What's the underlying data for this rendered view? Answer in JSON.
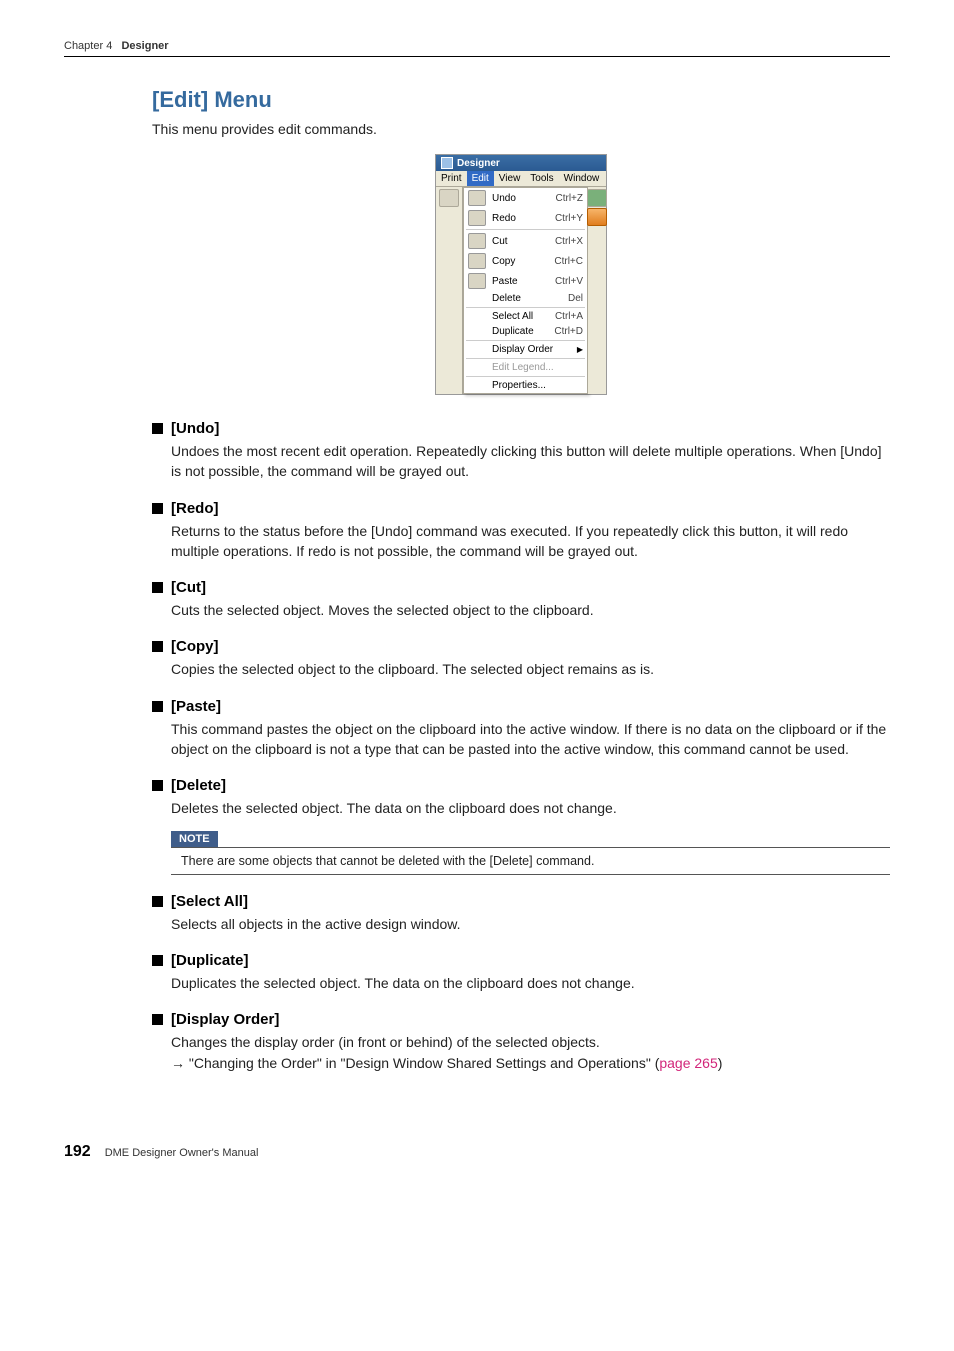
{
  "header": {
    "chapter": "Chapter 4",
    "chapter_title": "Designer"
  },
  "section": {
    "title": "[Edit] Menu",
    "intro": "This menu provides edit commands."
  },
  "menu_shot": {
    "window_title": "Designer",
    "menubar": [
      "Print",
      "Edit",
      "View",
      "Tools",
      "Window"
    ],
    "selected_index": 1,
    "items": [
      {
        "icon": true,
        "label": "Undo",
        "accel": "Ctrl+Z"
      },
      {
        "icon": true,
        "label": "Redo",
        "accel": "Ctrl+Y"
      },
      {
        "sep": true
      },
      {
        "icon": true,
        "label": "Cut",
        "accel": "Ctrl+X"
      },
      {
        "icon": true,
        "label": "Copy",
        "accel": "Ctrl+C"
      },
      {
        "icon": true,
        "label": "Paste",
        "accel": "Ctrl+V"
      },
      {
        "icon": false,
        "label": "Delete",
        "accel": "Del"
      },
      {
        "sep": true
      },
      {
        "icon": false,
        "label": "Select All",
        "accel": "Ctrl+A"
      },
      {
        "icon": false,
        "label": "Duplicate",
        "accel": "Ctrl+D"
      },
      {
        "sep": true
      },
      {
        "icon": false,
        "label": "Display Order",
        "submenu": true
      },
      {
        "sep": true
      },
      {
        "icon": false,
        "label": "Edit Legend...",
        "disabled": true
      },
      {
        "sep": true
      },
      {
        "icon": false,
        "label": "Properties..."
      }
    ]
  },
  "entries": [
    {
      "title": "[Undo]",
      "body": "Undoes the most recent edit operation. Repeatedly clicking this button will delete multiple operations. When [Undo] is not possible, the command will be grayed out."
    },
    {
      "title": "[Redo]",
      "body": "Returns to the status before the [Undo] command was executed. If you repeatedly click this button, it will redo multiple operations. If redo is not possible, the command will be grayed out."
    },
    {
      "title": "[Cut]",
      "body": "Cuts the selected object. Moves the selected object to the clipboard."
    },
    {
      "title": "[Copy]",
      "body": "Copies the selected object to the clipboard. The selected object remains as is."
    },
    {
      "title": "[Paste]",
      "body": "This command pastes the object on the clipboard into the active window. If there is no data on the clipboard or if the object on the clipboard is not a type that can be pasted into the active window, this command cannot be used."
    },
    {
      "title": "[Delete]",
      "body": "Deletes the selected object. The data on the clipboard does not change.",
      "note": "There are some objects that cannot be deleted with the [Delete] command."
    },
    {
      "title": "[Select All]",
      "body": "Selects all objects in the active design window."
    },
    {
      "title": "[Duplicate]",
      "body": "Duplicates the selected object. The data on the clipboard does not change."
    },
    {
      "title": "[Display Order]",
      "body": "Changes the display order (in front or behind) of the selected objects.",
      "ref_prefix": "→ \"Changing the Order\" in \"Design Window Shared Settings and Operations\" (",
      "ref_link": "page 265",
      "ref_suffix": ")"
    }
  ],
  "note_label": "NOTE",
  "footer": {
    "page": "192",
    "text": "DME Designer Owner's Manual"
  }
}
